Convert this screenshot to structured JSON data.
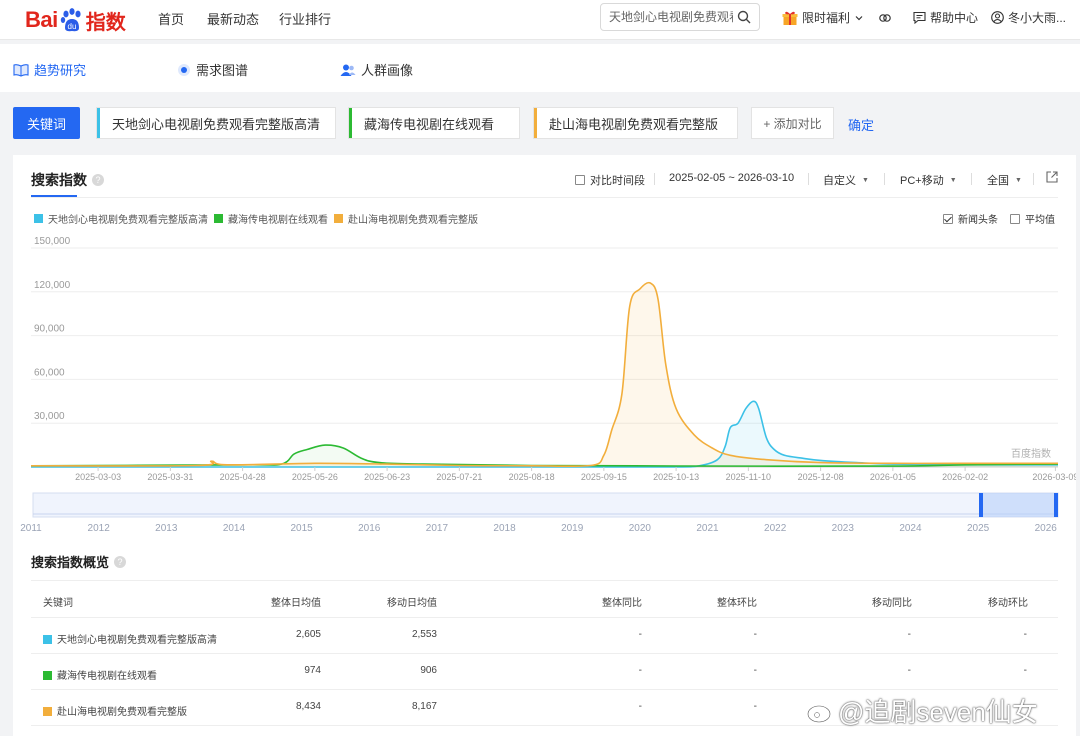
{
  "nav": {
    "logo_text": "Bai",
    "logo_suffix": "指数",
    "links": [
      "首页",
      "最新动态",
      "行业排行"
    ],
    "search_value": "天地剑心电视剧免费观看",
    "welfare": "限时福利",
    "help": "帮助中心",
    "user": "冬小大雨..."
  },
  "subtabs": [
    "趋势研究",
    "需求图谱",
    "人群画像"
  ],
  "keywords": {
    "button": "关键词",
    "items": [
      {
        "text": "天地剑心电视剧免费观看完整版高清",
        "color": "#3cc1e7"
      },
      {
        "text": "藏海传电视剧在线观看",
        "color": "#2cba33"
      },
      {
        "text": "赴山海电视剧免费观看完整版",
        "color": "#f2ae3c"
      }
    ],
    "add": "+ 添加对比",
    "confirm": "确定"
  },
  "card": {
    "title": "搜索指数",
    "compare": "对比时间段",
    "date_range": "2025-02-05 ~ 2026-03-10",
    "custom": "自定义",
    "device": "PC+移动",
    "region": "全国",
    "news": "新闻头条",
    "average": "平均值",
    "watermark": "百度指数"
  },
  "chart_data": {
    "type": "area",
    "title": "搜索指数",
    "ylim": [
      0,
      150000
    ],
    "yticks": [
      "150,000",
      "120,000",
      "90,000",
      "60,000",
      "30,000"
    ],
    "xticks": [
      "2025-03-03",
      "2025-03-31",
      "2025-04-28",
      "2025-05-26",
      "2025-06-23",
      "2025-07-21",
      "2025-08-18",
      "2025-09-15",
      "2025-10-13",
      "2025-11-10",
      "2025-12-08",
      "2026-01-05",
      "2026-02-02",
      "2026-03-09"
    ],
    "x_start": "2025-02-05",
    "x_end": "2026-03-10",
    "series": [
      {
        "name": "天地剑心电视剧免费观看完整版高清",
        "color": "#3cc1e7",
        "points": [
          [
            "2025-02-05",
            0
          ],
          [
            "2025-09-15",
            0
          ],
          [
            "2025-10-13",
            0
          ],
          [
            "2025-10-22",
            800
          ],
          [
            "2025-10-29",
            5000
          ],
          [
            "2025-11-01",
            14000
          ],
          [
            "2025-11-03",
            27000
          ],
          [
            "2025-11-06",
            30000
          ],
          [
            "2025-11-09",
            40000
          ],
          [
            "2025-11-12",
            45000
          ],
          [
            "2025-11-14",
            40000
          ],
          [
            "2025-11-17",
            20000
          ],
          [
            "2025-11-20",
            12000
          ],
          [
            "2025-11-24",
            8000
          ],
          [
            "2025-12-01",
            6000
          ],
          [
            "2025-12-08",
            4500
          ],
          [
            "2025-12-22",
            3000
          ],
          [
            "2026-01-05",
            2000
          ],
          [
            "2026-02-02",
            1500
          ],
          [
            "2026-03-10",
            1500
          ]
        ]
      },
      {
        "name": "藏海传电视剧在线观看",
        "color": "#2cba33",
        "points": [
          [
            "2025-02-05",
            800
          ],
          [
            "2025-04-28",
            1500
          ],
          [
            "2025-05-13",
            2000
          ],
          [
            "2025-05-18",
            9000
          ],
          [
            "2025-05-23",
            12000
          ],
          [
            "2025-05-30",
            15000
          ],
          [
            "2025-06-06",
            13000
          ],
          [
            "2025-06-13",
            6000
          ],
          [
            "2025-06-20",
            3000
          ],
          [
            "2025-07-07",
            2000
          ],
          [
            "2025-08-18",
            1000
          ],
          [
            "2025-10-13",
            700
          ],
          [
            "2026-01-05",
            600
          ],
          [
            "2026-02-02",
            1500
          ],
          [
            "2026-03-10",
            2000
          ]
        ]
      },
      {
        "name": "赴山海电视剧免费观看完整版",
        "color": "#f2ae3c",
        "points": [
          [
            "2025-02-05",
            800
          ],
          [
            "2025-04-10",
            1000
          ],
          [
            "2025-04-16",
            4000
          ],
          [
            "2025-04-22",
            1500
          ],
          [
            "2025-05-26",
            2500
          ],
          [
            "2025-06-23",
            2000
          ],
          [
            "2025-07-21",
            1000
          ],
          [
            "2025-08-18",
            800
          ],
          [
            "2025-09-10",
            1000
          ],
          [
            "2025-09-15",
            8000
          ],
          [
            "2025-09-18",
            25000
          ],
          [
            "2025-09-22",
            50000
          ],
          [
            "2025-09-25",
            110000
          ],
          [
            "2025-09-29",
            122000
          ],
          [
            "2025-10-03",
            126000
          ],
          [
            "2025-10-06",
            115000
          ],
          [
            "2025-10-09",
            70000
          ],
          [
            "2025-10-13",
            40000
          ],
          [
            "2025-10-20",
            22000
          ],
          [
            "2025-10-27",
            13000
          ],
          [
            "2025-11-03",
            8000
          ],
          [
            "2025-11-17",
            5000
          ],
          [
            "2025-12-08",
            3000
          ],
          [
            "2026-01-05",
            2500
          ],
          [
            "2026-02-02",
            2500
          ],
          [
            "2026-03-10",
            2500
          ]
        ]
      }
    ],
    "range_years": [
      "2011",
      "2012",
      "2013",
      "2014",
      "2015",
      "2016",
      "2017",
      "2018",
      "2019",
      "2020",
      "2021",
      "2022",
      "2023",
      "2024",
      "2025",
      "2026"
    ]
  },
  "overview": {
    "title": "搜索指数概览",
    "headers": [
      "关键词",
      "整体日均值",
      "移动日均值",
      "整体同比",
      "整体环比",
      "移动同比",
      "移动环比"
    ],
    "rows": [
      {
        "name": "天地剑心电视剧免费观看完整版高清",
        "color": "#3cc1e7",
        "overall": "2,605",
        "mobile": "2,553",
        "yoy": "-",
        "mom": "-",
        "myoy": "-",
        "mmom": "-"
      },
      {
        "name": "藏海传电视剧在线观看",
        "color": "#2cba33",
        "overall": "974",
        "mobile": "906",
        "yoy": "-",
        "mom": "-",
        "myoy": "-",
        "mmom": "-"
      },
      {
        "name": "赴山海电视剧免费观看完整版",
        "color": "#f2ae3c",
        "overall": "8,434",
        "mobile": "8,167",
        "yoy": "-",
        "mom": "-",
        "myoy": "-",
        "mmom": "-"
      }
    ]
  },
  "watermark_text": "@追剧seven仙女"
}
